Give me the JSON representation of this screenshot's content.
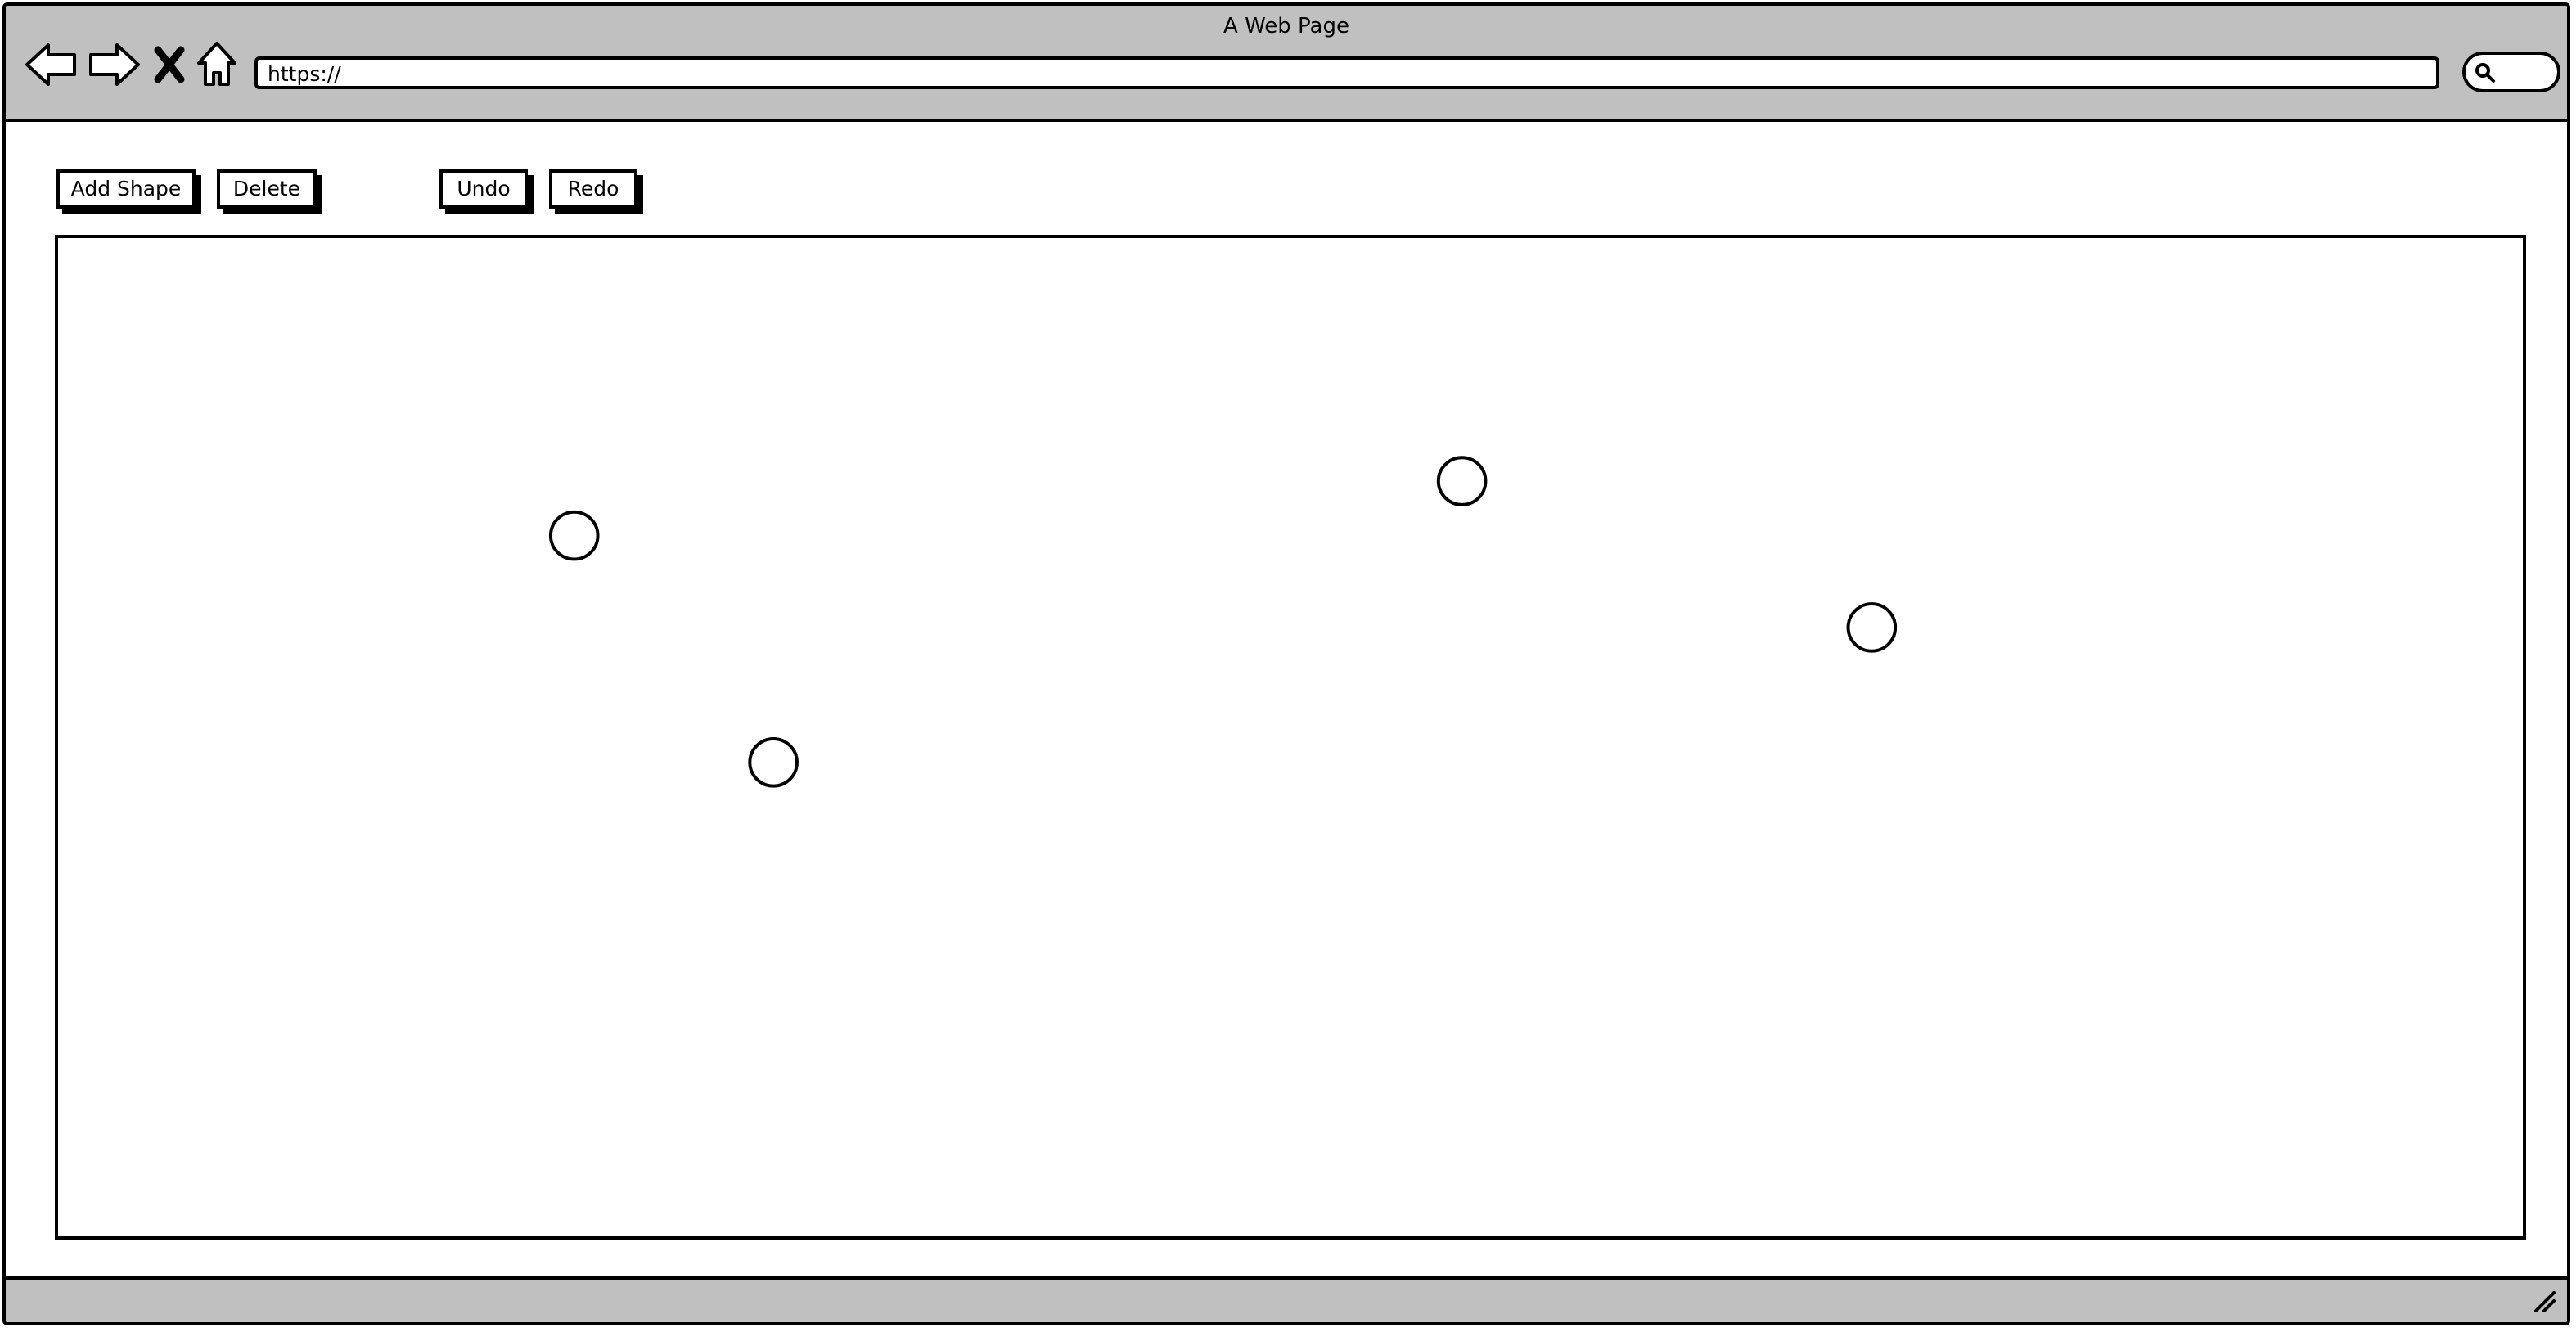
{
  "window": {
    "title": "A Web Page"
  },
  "navbar": {
    "back_icon": "arrow-left-icon",
    "forward_icon": "arrow-right-icon",
    "stop_icon": "close-icon",
    "home_icon": "home-icon",
    "address_value": "https://",
    "search_icon": "search-icon"
  },
  "toolbar": {
    "add_shape_label": "Add Shape",
    "delete_label": "Delete",
    "undo_label": "Undo",
    "redo_label": "Redo"
  },
  "canvas": {
    "shapes": [
      {
        "type": "circle"
      },
      {
        "type": "circle"
      },
      {
        "type": "circle"
      },
      {
        "type": "circle"
      }
    ]
  },
  "colors": {
    "chrome": "#c0c0c0",
    "ink": "#000000",
    "paper": "#ffffff"
  }
}
